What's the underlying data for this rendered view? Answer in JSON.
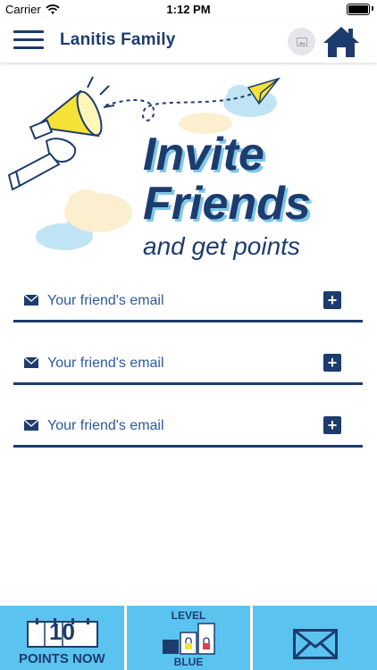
{
  "status_bar": {
    "carrier": "Carrier",
    "time": "1:12 PM"
  },
  "nav": {
    "title": "Lanitis Family"
  },
  "hero": {
    "line1": "Invite",
    "line2": "Friends",
    "line3": "and get points"
  },
  "email_fields": [
    {
      "placeholder": "Your friend's email",
      "value": ""
    },
    {
      "placeholder": "Your friend's email",
      "value": ""
    },
    {
      "placeholder": "Your friend's email",
      "value": ""
    }
  ],
  "tab_bar": {
    "points": {
      "value": "10",
      "label": "POINTS NOW"
    },
    "level": {
      "label_top": "LEVEL",
      "label_bottom": "BLUE"
    },
    "messages": {
      "icon": "mail-icon"
    }
  },
  "colors": {
    "navy": "#1d3c6e",
    "tab_blue": "#5ac3ef",
    "accent_yellow": "#f5e236"
  }
}
